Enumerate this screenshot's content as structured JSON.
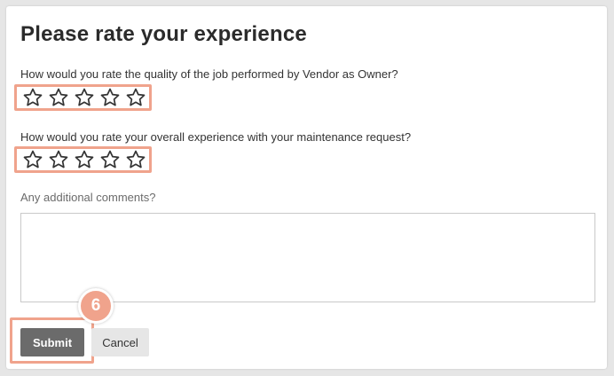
{
  "form": {
    "title": "Please rate your experience",
    "question1": {
      "label": "How would you rate the quality of the job performed by Vendor as Owner?",
      "rating": 0,
      "max": 5
    },
    "question2": {
      "label": "How would you rate your overall experience with your maintenance request?",
      "rating": 0,
      "max": 5
    },
    "comments": {
      "label": "Any additional comments?",
      "value": ""
    },
    "buttons": {
      "submit": "Submit",
      "cancel": "Cancel"
    }
  },
  "annotation": {
    "step_number": "6",
    "highlight_color": "#f0a38c"
  },
  "icons": {
    "rating_star": "star-outline-icon"
  },
  "colors": {
    "submit_bg": "#6b6b6b",
    "cancel_bg": "#e6e6e6",
    "page_bg": "#e6e6e6"
  }
}
